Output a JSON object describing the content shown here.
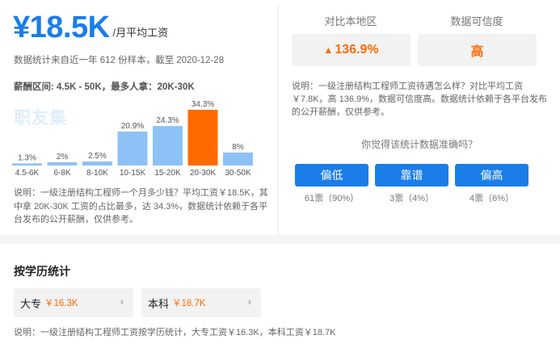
{
  "summary": {
    "salary": "¥18.5K",
    "unit": "/月平均工资",
    "sample_text": "数据统计来自近一年 612 份样本，截至 2020-12-28",
    "range_text": "薪酬区间: 4.5K - 50K，最多人拿：20K-30K",
    "watermark": "职友集",
    "note": "说明：一级注册结构工程师一个月多少钱？平均工资￥18.5K，其中拿 20K-30K 工资的占比最多，达 34.3%，数据统计依赖于各平台发布的公开薪酬，仅供参考。"
  },
  "chart_data": {
    "type": "bar",
    "categories": [
      "4.5-6K",
      "6-8K",
      "8-10K",
      "10-15K",
      "15-20K",
      "20-30K",
      "30-50K"
    ],
    "values": [
      1.3,
      2,
      2.5,
      20.9,
      24.3,
      34.3,
      8
    ],
    "value_labels": [
      "1.3%",
      "2%",
      "2.5%",
      "20.9%",
      "24.3%",
      "34.3%",
      "8%"
    ],
    "highlight_index": 5,
    "colors": {
      "normal": "#8ec2f6",
      "highlight": "#ff6a00",
      "label": "#555555"
    },
    "ylim": [
      0,
      34.3
    ]
  },
  "comparison": {
    "local_label": "对比本地区",
    "local_value": "136.9%",
    "local_icon": "up-arrow-icon",
    "credibility_label": "数据可信度",
    "credibility_value": "高",
    "note": "说明：一级注册结构工程师工资待遇怎么样？对比平均工资￥7.8K，高 136.9%，数据可信度高。数据统计依赖于各平台发布的公开薪酬，仅供参考。"
  },
  "poll": {
    "question": "你觉得该统计数据准确吗？",
    "options": [
      {
        "label": "偏低",
        "count": "61票（90%）"
      },
      {
        "label": "靠谱",
        "count": "3票（4%）"
      },
      {
        "label": "偏高",
        "count": "4票（6%）"
      }
    ]
  },
  "education": {
    "title": "按学历统计",
    "items": [
      {
        "name": "大专",
        "value": "￥16.3K"
      },
      {
        "name": "本科",
        "value": "￥18.7K"
      }
    ],
    "chevron_icon": "chevron-right-icon",
    "note": "说明：一级注册结构工程师工资按学历统计，大专工资￥16.3K，本科工资￥18.7K"
  }
}
